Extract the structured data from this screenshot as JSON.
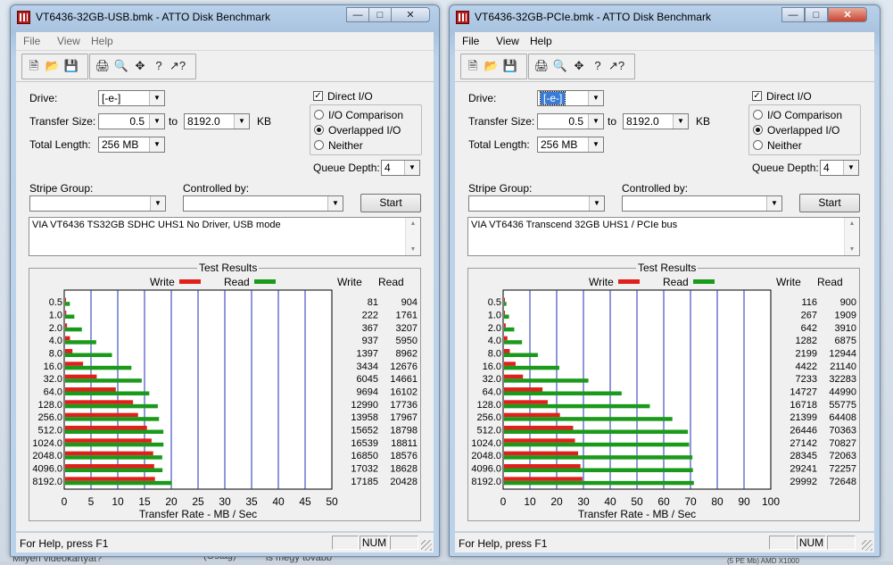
{
  "background": {
    "texts": [
      "Milyen videókártyát?",
      "(Ostag)",
      "is megy tovább",
      "(5 PE Mb) AMD X1000"
    ]
  },
  "windows": [
    {
      "title": "VT6436-32GB-USB.bmk - ATTO Disk Benchmark",
      "menu": [
        "File",
        "View",
        "Help"
      ],
      "drive_label": "Drive:",
      "drive_value": "[-e-]",
      "transfer_size_label": "Transfer Size:",
      "transfer_from": "0.5",
      "to_label": "to",
      "transfer_to": "8192.0",
      "kb_label": "KB",
      "total_length_label": "Total Length:",
      "total_length_value": "256 MB",
      "direct_io_label": "Direct I/O",
      "io_comparison_label": "I/O Comparison",
      "overlapped_io_label": "Overlapped I/O",
      "neither_label": "Neither",
      "queue_depth_label": "Queue Depth:",
      "queue_depth_value": "4",
      "stripe_group_label": "Stripe Group:",
      "controlled_by_label": "Controlled by:",
      "start_label": "Start",
      "description": "VIA VT6436 TS32GB SDHC UHS1 No Driver, USB mode",
      "results_title": "Test Results",
      "legend_write": "Write",
      "legend_read": "Read",
      "col_write": "Write",
      "col_read": "Read",
      "status_text": "For Help, press F1",
      "status_num": "NUM"
    },
    {
      "title": "VT6436-32GB-PCIe.bmk - ATTO Disk Benchmark",
      "menu": [
        "File",
        "View",
        "Help"
      ],
      "drive_label": "Drive:",
      "drive_value": "[-e-]",
      "transfer_size_label": "Transfer Size:",
      "transfer_from": "0.5",
      "to_label": "to",
      "transfer_to": "8192.0",
      "kb_label": "KB",
      "total_length_label": "Total Length:",
      "total_length_value": "256 MB",
      "direct_io_label": "Direct I/O",
      "io_comparison_label": "I/O Comparison",
      "overlapped_io_label": "Overlapped I/O",
      "neither_label": "Neither",
      "queue_depth_label": "Queue Depth:",
      "queue_depth_value": "4",
      "stripe_group_label": "Stripe Group:",
      "controlled_by_label": "Controlled by:",
      "start_label": "Start",
      "description": "VIA VT6436 Transcend 32GB UHS1 / PCIe bus",
      "results_title": "Test Results",
      "legend_write": "Write",
      "legend_read": "Read",
      "col_write": "Write",
      "col_read": "Read",
      "status_text": "For Help, press F1",
      "status_num": "NUM"
    }
  ],
  "chart_data": [
    {
      "type": "bar",
      "orientation": "horizontal",
      "categories": [
        "0.5",
        "1.0",
        "2.0",
        "4.0",
        "8.0",
        "16.0",
        "32.0",
        "64.0",
        "128.0",
        "256.0",
        "512.0",
        "1024.0",
        "2048.0",
        "4096.0",
        "8192.0"
      ],
      "xlabel": "Transfer Rate - MB / Sec",
      "xlim": [
        0,
        50
      ],
      "xticks": [
        "0",
        "5",
        "10",
        "15",
        "20",
        "25",
        "30",
        "35",
        "40",
        "45",
        "50"
      ],
      "series": [
        {
          "name": "Write",
          "color": "#e0201a",
          "values": [
            81,
            222,
            367,
            937,
            1397,
            3434,
            6045,
            9694,
            12990,
            13958,
            15652,
            16539,
            16850,
            17032,
            17185
          ]
        },
        {
          "name": "Read",
          "color": "#1a9a1a",
          "values": [
            904,
            1761,
            3207,
            5950,
            8962,
            12676,
            14661,
            16102,
            17736,
            17967,
            18798,
            18811,
            18576,
            18628,
            20428
          ]
        }
      ]
    },
    {
      "type": "bar",
      "orientation": "horizontal",
      "categories": [
        "0.5",
        "1.0",
        "2.0",
        "4.0",
        "8.0",
        "16.0",
        "32.0",
        "64.0",
        "128.0",
        "256.0",
        "512.0",
        "1024.0",
        "2048.0",
        "4096.0",
        "8192.0"
      ],
      "xlabel": "Transfer Rate - MB / Sec",
      "xlim": [
        0,
        100
      ],
      "xticks": [
        "0",
        "10",
        "20",
        "30",
        "40",
        "50",
        "60",
        "70",
        "80",
        "90",
        "100"
      ],
      "series": [
        {
          "name": "Write",
          "color": "#e0201a",
          "values": [
            116,
            267,
            642,
            1282,
            2199,
            4422,
            7233,
            14727,
            16718,
            21399,
            26446,
            27142,
            28345,
            29241,
            29992
          ]
        },
        {
          "name": "Read",
          "color": "#1a9a1a",
          "values": [
            900,
            1909,
            3910,
            6875,
            12944,
            21140,
            32283,
            44990,
            55775,
            64408,
            70363,
            70827,
            72063,
            72257,
            72648
          ]
        }
      ]
    }
  ]
}
